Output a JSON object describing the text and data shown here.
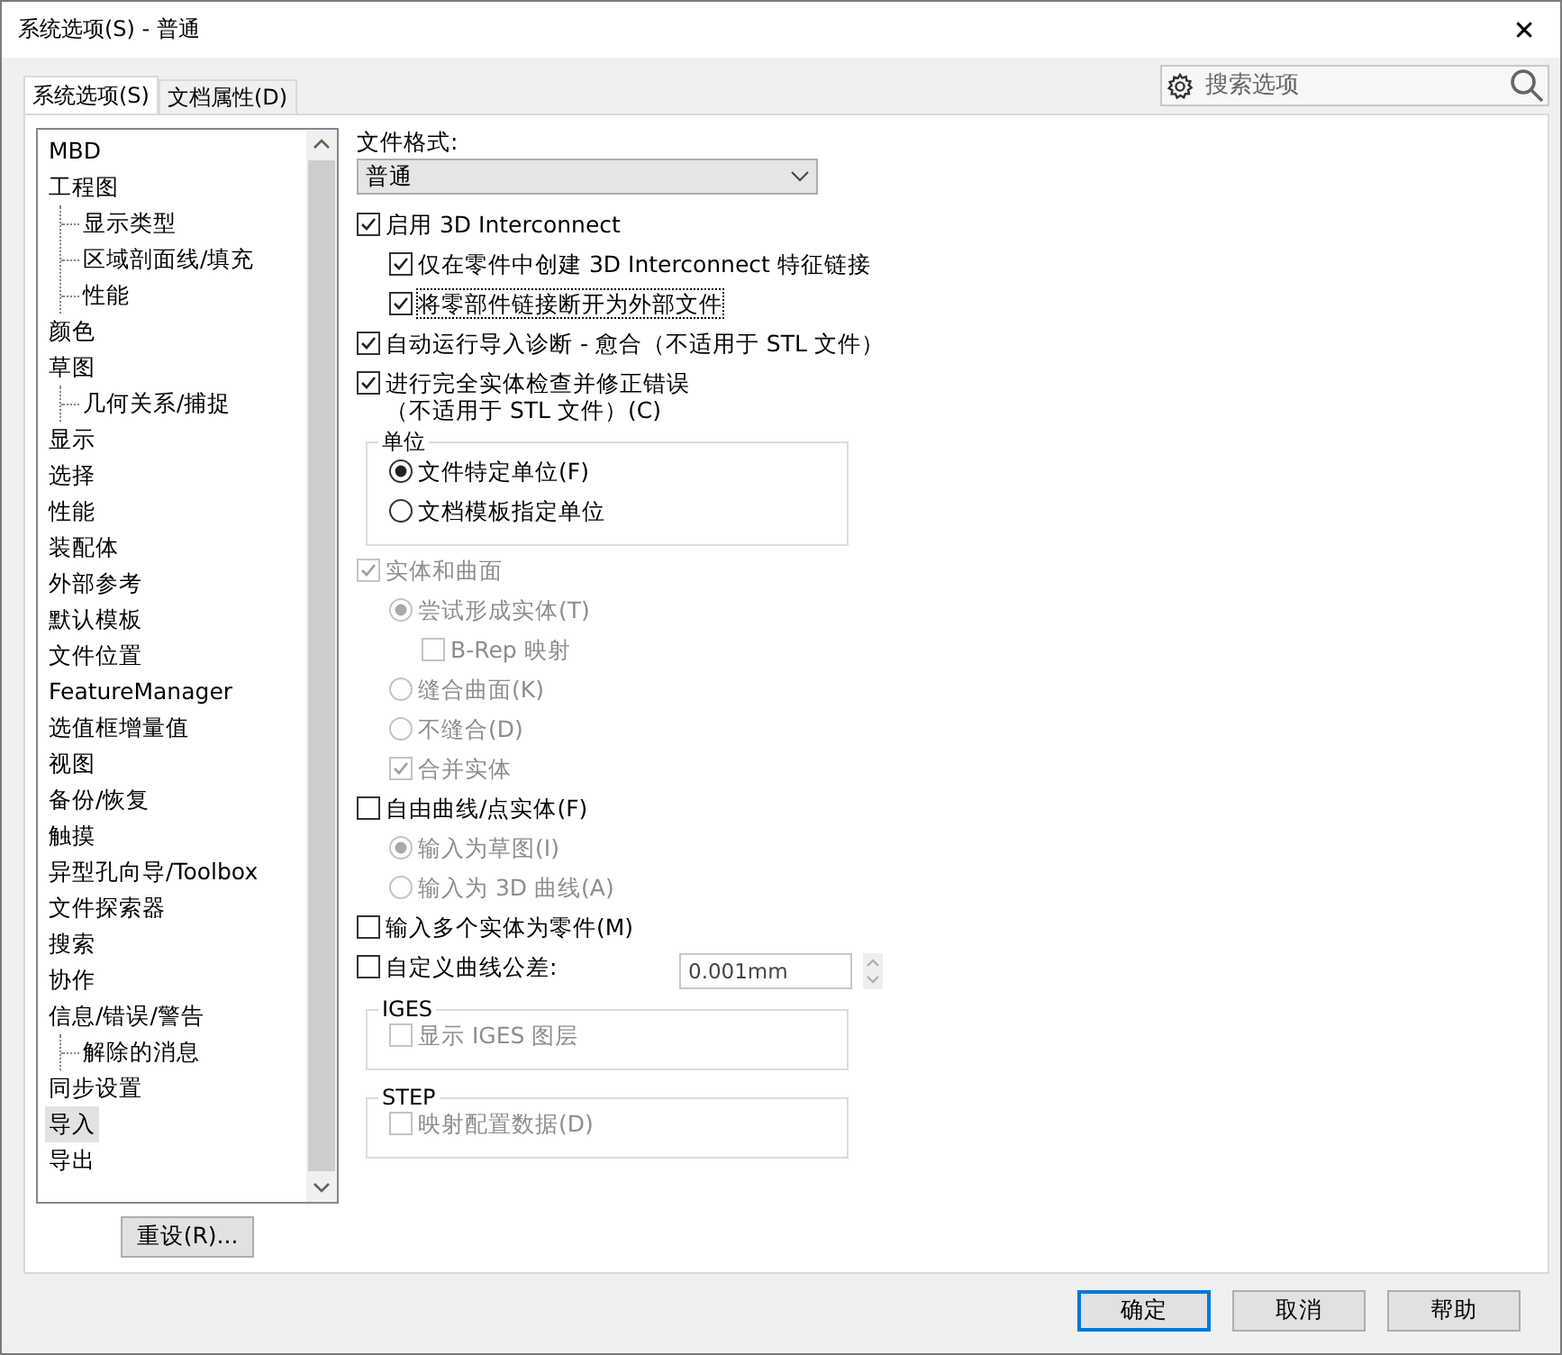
{
  "window": {
    "title": "系统选项(S) - 普通",
    "close": "✕"
  },
  "tabs": [
    {
      "label": "系统选项(S)",
      "selected": true
    },
    {
      "label": "文档属性(D)",
      "selected": false
    }
  ],
  "search": {
    "placeholder": "搜索选项"
  },
  "tree": [
    {
      "label": "MBD",
      "selected": false
    },
    {
      "label": "工程图",
      "selected": false,
      "children": [
        {
          "label": "显示类型",
          "selected": false
        },
        {
          "label": "区域剖面线/填充",
          "selected": false
        },
        {
          "label": "性能",
          "selected": false
        }
      ]
    },
    {
      "label": "颜色",
      "selected": false
    },
    {
      "label": "草图",
      "selected": false,
      "children": [
        {
          "label": "几何关系/捕捉",
          "selected": false
        }
      ]
    },
    {
      "label": "显示",
      "selected": false
    },
    {
      "label": "选择",
      "selected": false
    },
    {
      "label": "性能",
      "selected": false
    },
    {
      "label": "装配体",
      "selected": false
    },
    {
      "label": "外部参考",
      "selected": false
    },
    {
      "label": "默认模板",
      "selected": false
    },
    {
      "label": "文件位置",
      "selected": false
    },
    {
      "label": "FeatureManager",
      "selected": false
    },
    {
      "label": "选值框增量值",
      "selected": false
    },
    {
      "label": "视图",
      "selected": false
    },
    {
      "label": "备份/恢复",
      "selected": false
    },
    {
      "label": "触摸",
      "selected": false
    },
    {
      "label": "异型孔向导/Toolbox",
      "selected": false
    },
    {
      "label": "文件探索器",
      "selected": false
    },
    {
      "label": "搜索",
      "selected": false
    },
    {
      "label": "协作",
      "selected": false
    },
    {
      "label": "信息/错误/警告",
      "selected": false,
      "children": [
        {
          "label": "解除的消息",
          "selected": false
        }
      ]
    },
    {
      "label": "同步设置",
      "selected": false
    },
    {
      "label": "导入",
      "selected": true
    },
    {
      "label": "导出",
      "selected": false
    }
  ],
  "reset_button": "重设(R)...",
  "file_format": {
    "label": "文件格式:",
    "value": "普通"
  },
  "options": [
    {
      "kind": "checkbox",
      "label": "启用 3D Interconnect",
      "checked": true,
      "disabled": false,
      "children": [
        {
          "kind": "checkbox",
          "label": "仅在零件中创建 3D Interconnect 特征链接",
          "checked": true,
          "disabled": false
        },
        {
          "kind": "checkbox",
          "label": "将零部件链接断开为外部文件",
          "checked": true,
          "disabled": false,
          "focused": true
        }
      ]
    },
    {
      "kind": "checkbox",
      "label": "自动运行导入诊断 - 愈合（不适用于 STL 文件）",
      "checked": true,
      "disabled": false
    },
    {
      "kind": "checkbox",
      "label": "进行完全实体检查并修正错误",
      "label_line_2": "（不适用于 STL 文件）(C)",
      "checked": true,
      "disabled": false
    },
    {
      "kind": "group",
      "title": "单位",
      "children": [
        {
          "kind": "radio",
          "label": "文件特定单位(F)",
          "selected": true,
          "disabled": false
        },
        {
          "kind": "radio",
          "label": "文档模板指定单位",
          "selected": false,
          "disabled": false
        }
      ]
    },
    {
      "kind": "checkbox",
      "label": "实体和曲面",
      "checked": true,
      "disabled": true,
      "children": [
        {
          "kind": "radio",
          "label": "尝试形成实体(T)",
          "selected": true,
          "disabled": true,
          "children": [
            {
              "kind": "checkbox",
              "label": "B-Rep 映射",
              "checked": false,
              "disabled": true
            }
          ]
        },
        {
          "kind": "radio",
          "label": "缝合曲面(K)",
          "selected": false,
          "disabled": true
        },
        {
          "kind": "radio",
          "label": "不缝合(D)",
          "selected": false,
          "disabled": true
        },
        {
          "kind": "checkbox",
          "label": "合并实体",
          "checked": true,
          "disabled": true
        }
      ]
    },
    {
      "kind": "checkbox",
      "label": "自由曲线/点实体(F)",
      "checked": false,
      "disabled": false,
      "children": [
        {
          "kind": "radio",
          "label": "输入为草图(I)",
          "selected": true,
          "disabled": true
        },
        {
          "kind": "radio",
          "label": "输入为 3D 曲线(A)",
          "selected": false,
          "disabled": true
        }
      ]
    },
    {
      "kind": "checkbox",
      "label": "输入多个实体为零件(M)",
      "checked": false,
      "disabled": false
    },
    {
      "kind": "number",
      "label": "自定义曲线公差:",
      "checked": false,
      "disabled": false,
      "value": "0.001mm"
    },
    {
      "kind": "group",
      "title": "IGES",
      "children": [
        {
          "kind": "checkbox",
          "label": "显示 IGES 图层",
          "checked": false,
          "disabled": true
        }
      ]
    },
    {
      "kind": "group",
      "title": "STEP",
      "children": [
        {
          "kind": "checkbox",
          "label": "映射配置数据(D)",
          "checked": false,
          "disabled": true
        }
      ]
    }
  ],
  "buttons": [
    {
      "label": "确定",
      "default": true
    },
    {
      "label": "取消",
      "default": false
    },
    {
      "label": "帮助",
      "default": false
    }
  ]
}
